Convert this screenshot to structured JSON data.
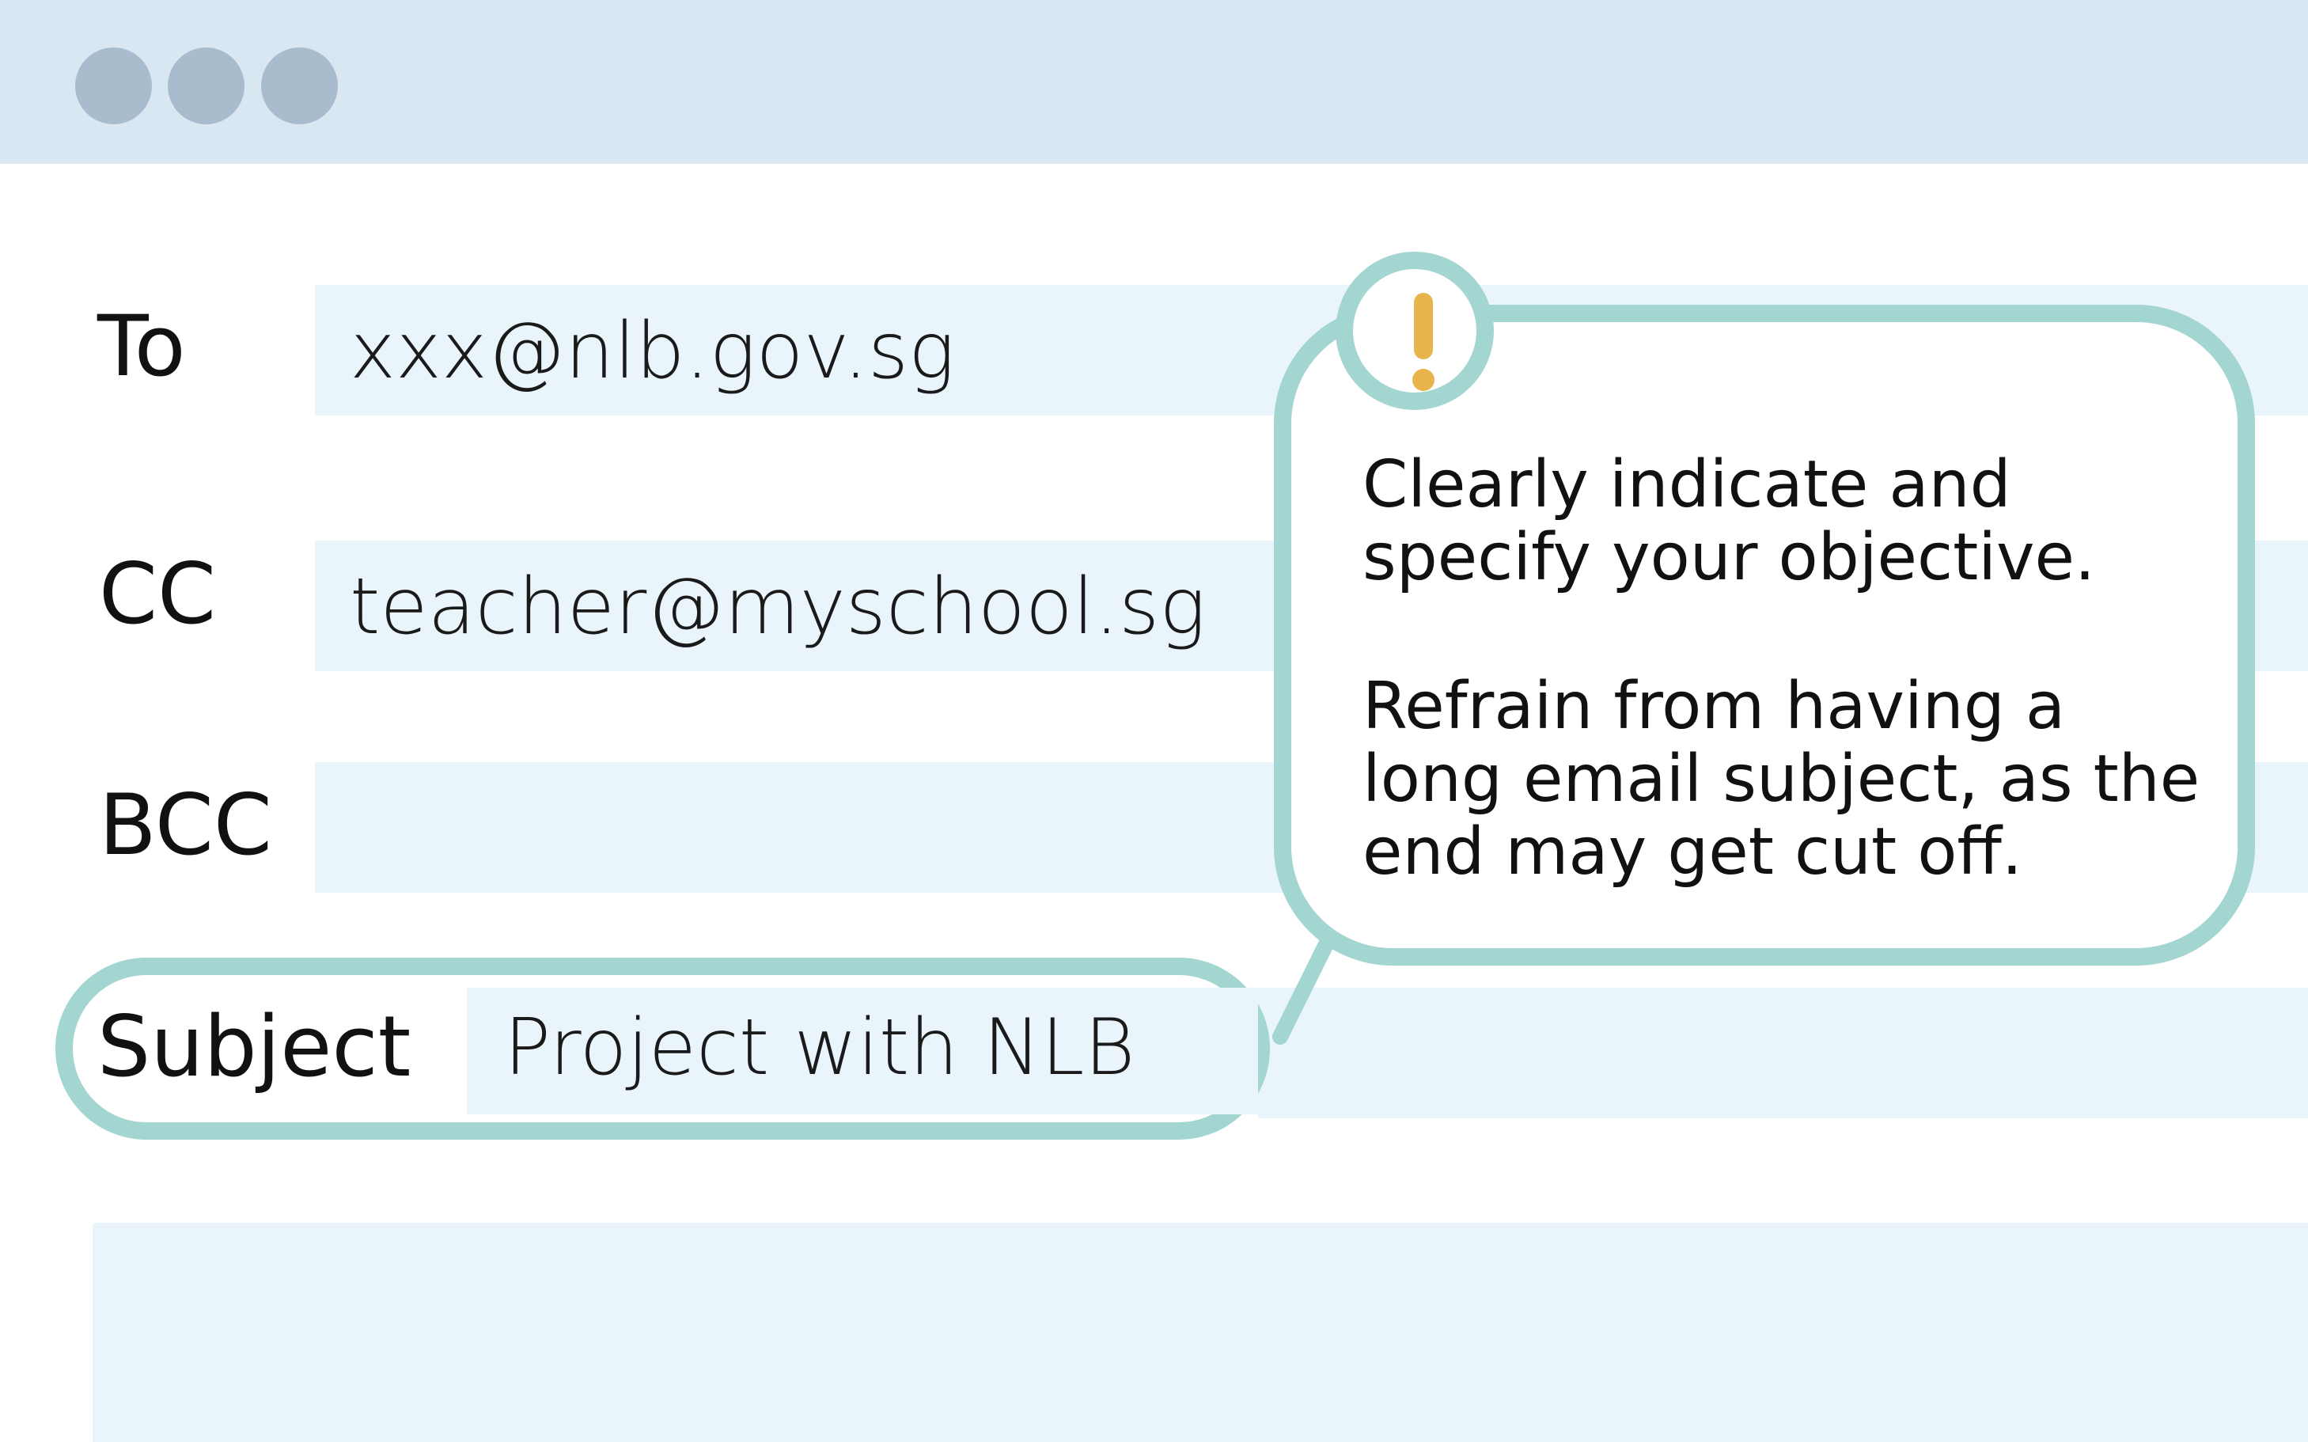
{
  "window": {
    "controls": [
      "close",
      "minimize",
      "maximize"
    ]
  },
  "fields": {
    "to": {
      "label": "To",
      "value": "xxx@nlb.gov.sg"
    },
    "cc": {
      "label": "CC",
      "value": "teacher@myschool.sg"
    },
    "bcc": {
      "label": "BCC",
      "value": ""
    },
    "subject": {
      "label": "Subject",
      "value": "Project with NLB"
    }
  },
  "callout": {
    "icon": "exclamation-icon",
    "paragraph1": "Clearly indicate and specify your objective.",
    "paragraph2": "Refrain from having a long email subject, as the end may get cut off."
  },
  "colors": {
    "titlebar": "#d9e7f2",
    "window_dots": "#a9bccd",
    "field_background": "#eaf4fb",
    "highlight_outline": "#a3d5d1",
    "alert_accent": "#e8b54d"
  }
}
